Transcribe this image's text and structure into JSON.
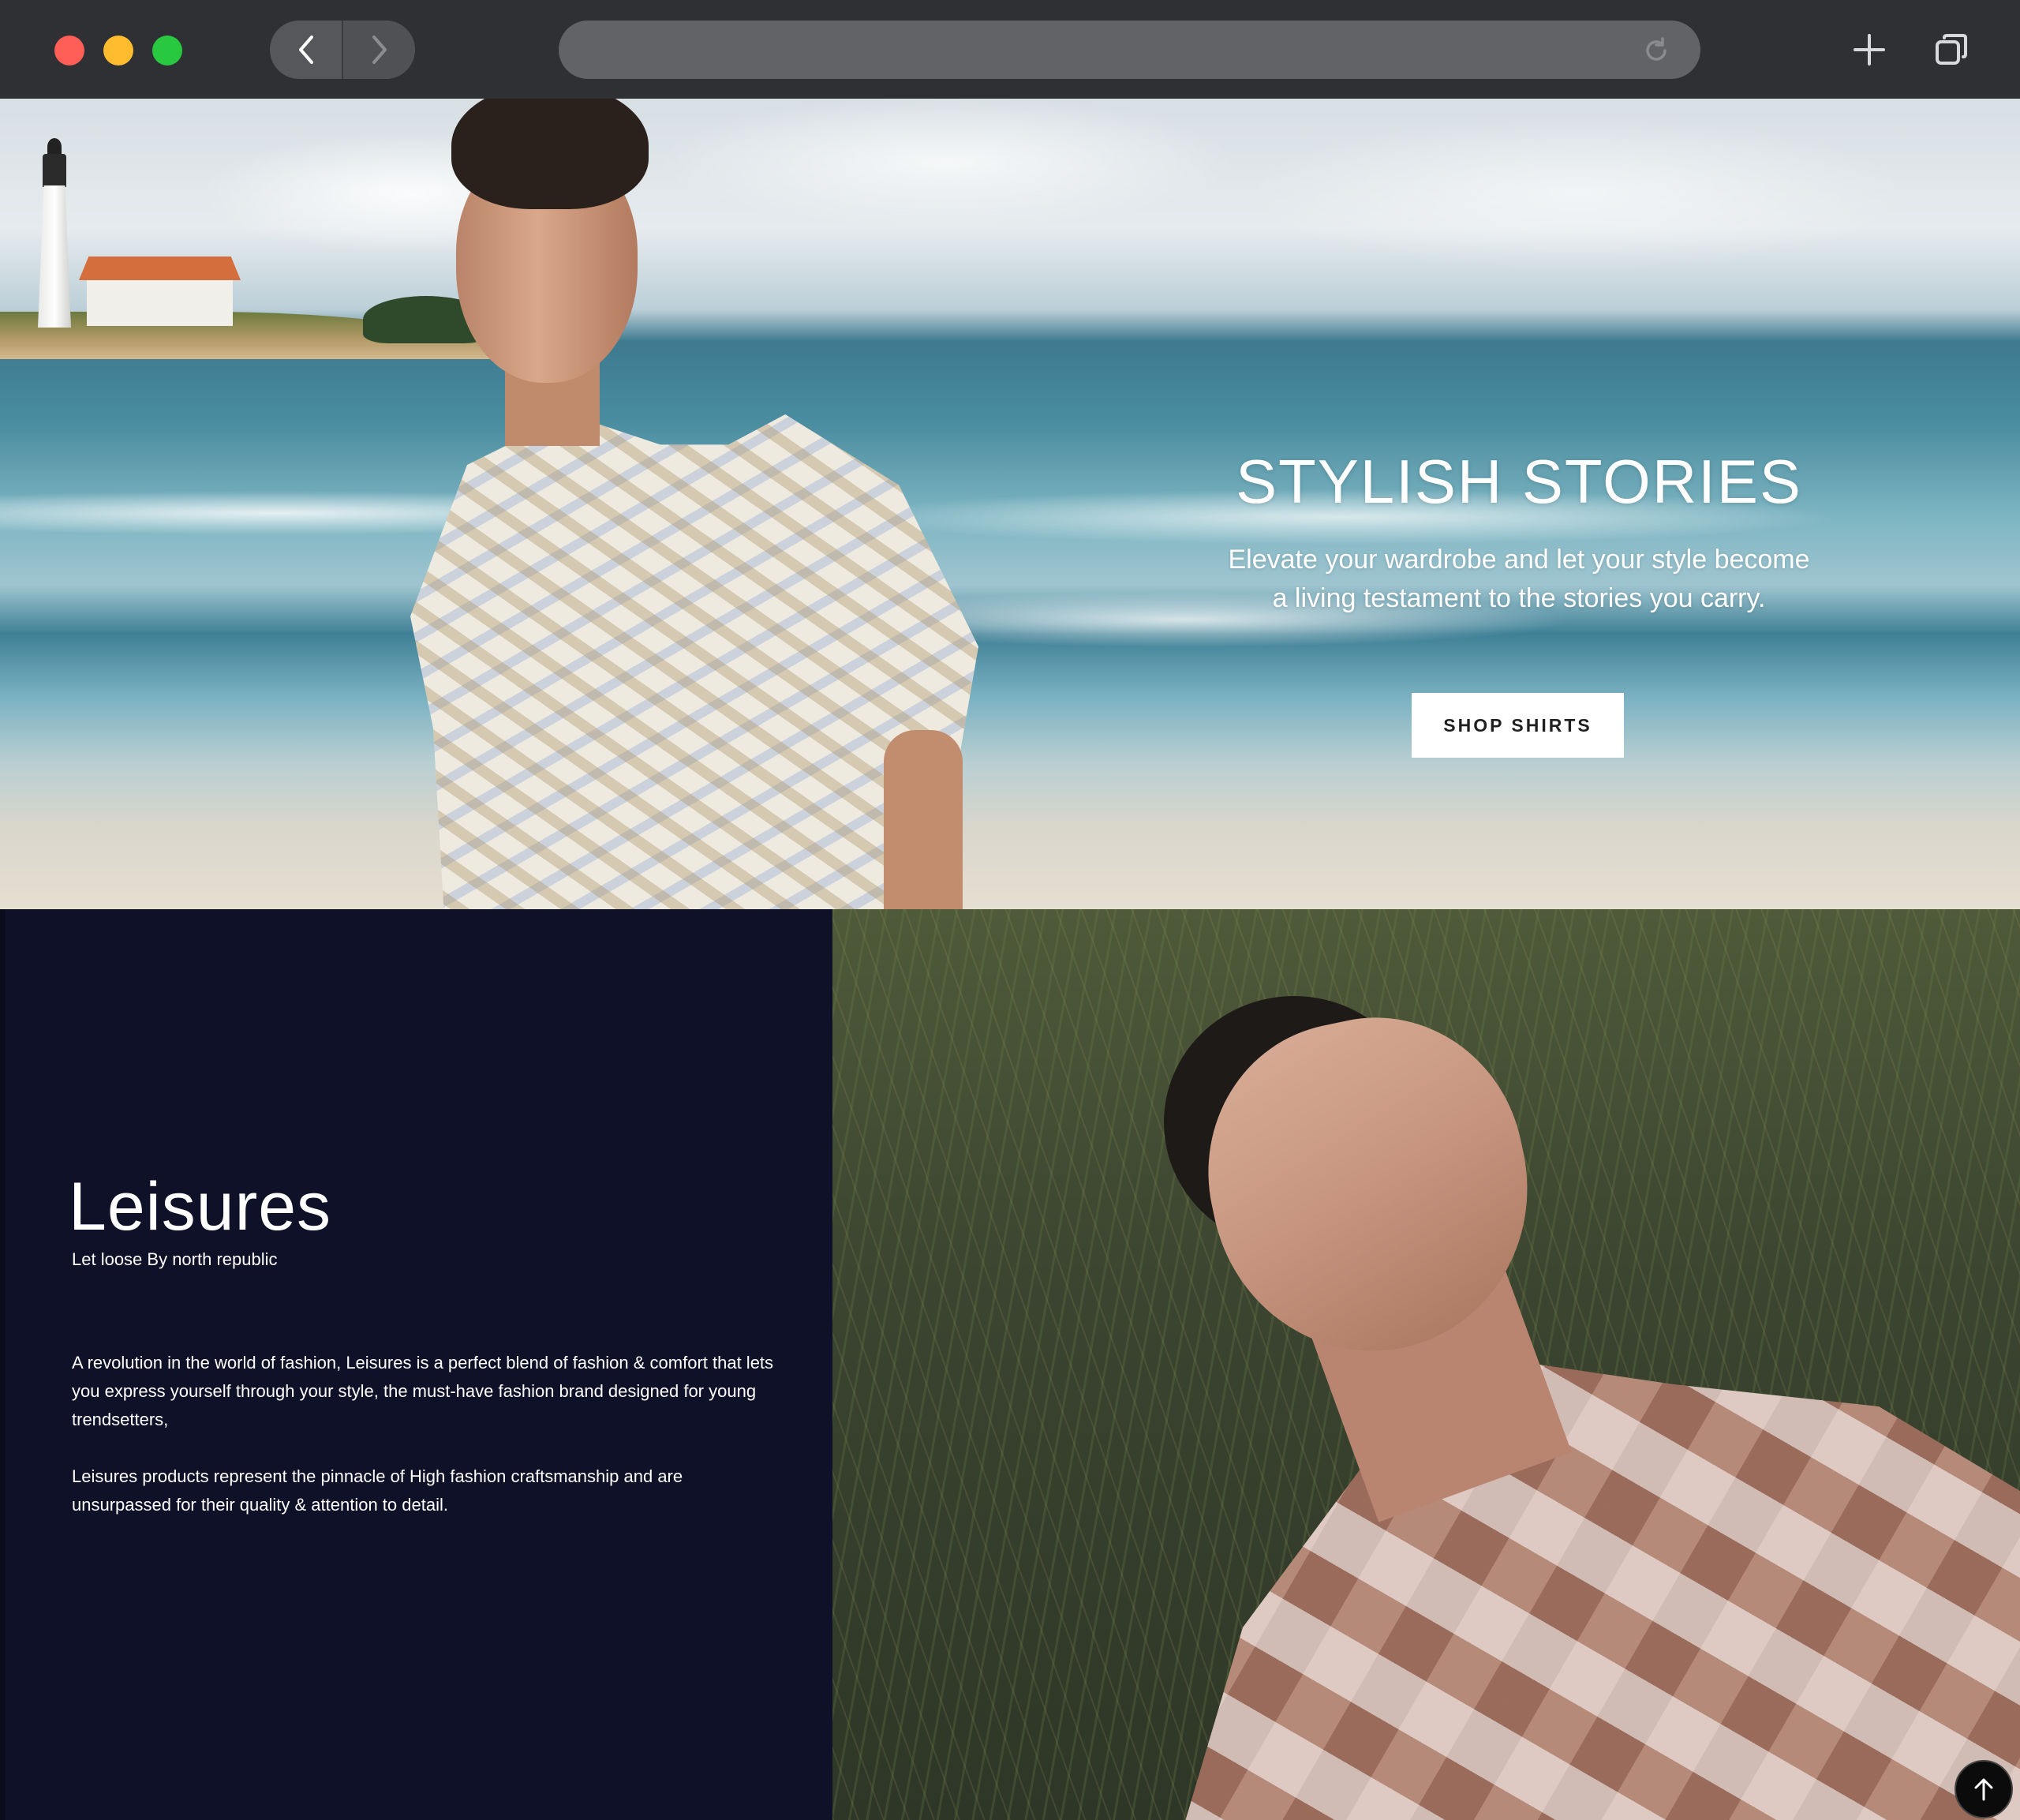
{
  "browser": {
    "traffic_lights": {
      "close": "#ff5f57",
      "minimize": "#febc2e",
      "zoom": "#28c840"
    },
    "icons": [
      "back-arrow-icon",
      "forward-arrow-icon",
      "reload-icon",
      "plus-icon",
      "tabs-icon"
    ],
    "url": ""
  },
  "hero": {
    "title": "STYLISH STORIES",
    "subtitle_line1": "Elevate your wardrobe and let your style become",
    "subtitle_line2": "a living testament to the stories you carry.",
    "cta_label": "SHOP SHIRTS"
  },
  "leisures": {
    "title": "Leisures",
    "tagline": "Let loose By north republic",
    "paragraph1": "A revolution in the world of fashion, Leisures is a perfect blend of fashion & comfort that lets you express yourself through your style, the must-have fashion brand designed for young trendsetters,",
    "paragraph2": "Leisures products represent the pinnacle of High fashion craftsmanship and are unsurpassed for their quality & attention to detail.",
    "panel_color": "#0f1129"
  },
  "back_to_top": {
    "icon": "arrow-up-icon"
  }
}
